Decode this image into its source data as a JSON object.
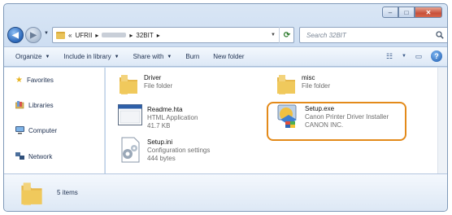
{
  "navigation": {
    "path": [
      "«",
      "UFRII",
      "32BIT"
    ],
    "search_placeholder": "Search 32BIT"
  },
  "toolbar": {
    "organize": "Organize",
    "include_in_library": "Include in library",
    "share_with": "Share with",
    "burn": "Burn",
    "new_folder": "New folder"
  },
  "sidebar": {
    "favorites": "Favorites",
    "libraries": "Libraries",
    "computer": "Computer",
    "network": "Network"
  },
  "files": [
    {
      "name": "Driver",
      "line1": "File folder",
      "line2": "",
      "icon": "folder-icon"
    },
    {
      "name": "misc",
      "line1": "File folder",
      "line2": "",
      "icon": "folder-icon"
    },
    {
      "name": "Readme.hta",
      "line1": "HTML Application",
      "line2": "41.7 KB",
      "icon": "hta-file-icon"
    },
    {
      "name": "Setup.exe",
      "line1": "Canon Printer Driver Installer",
      "line2": "CANON INC.",
      "icon": "setup-installer-icon"
    },
    {
      "name": "Setup.ini",
      "line1": "Configuration settings",
      "line2": "444 bytes",
      "icon": "settings-file-icon"
    }
  ],
  "status": {
    "item_count": "5 items"
  },
  "colors": {
    "highlight": "#e38a1a"
  }
}
